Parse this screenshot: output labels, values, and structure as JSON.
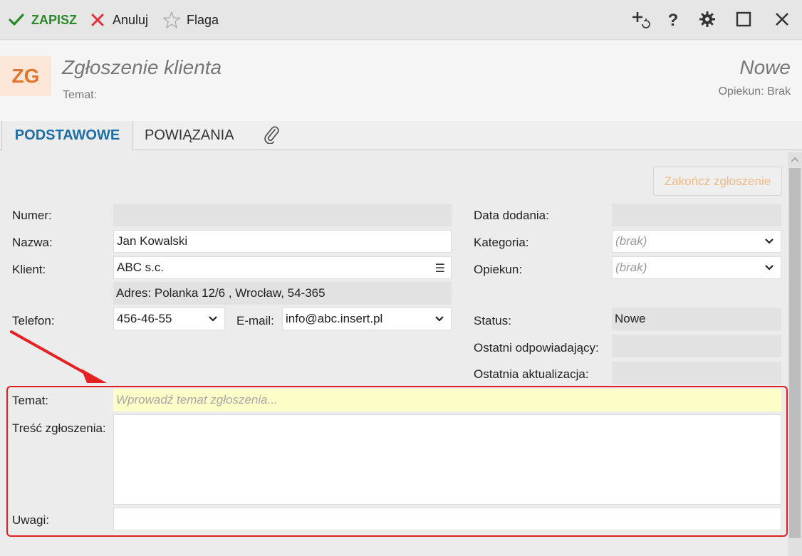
{
  "toolbar": {
    "save_label": "ZAPISZ",
    "cancel_label": "Anuluj",
    "flag_label": "Flaga"
  },
  "header": {
    "avatar_initials": "ZG",
    "title": "Zgłoszenie klienta",
    "subject_label": "Temat:",
    "status": "Nowe",
    "owner": "Opiekun: Brak"
  },
  "tabs": {
    "basic": "PODSTAWOWE",
    "relations": "POWIĄZANIA"
  },
  "actions": {
    "finish_label": "Zakończ zgłoszenie"
  },
  "form": {
    "numer_label": "Numer:",
    "numer_value": "",
    "nazwa_label": "Nazwa:",
    "nazwa_value": "Jan Kowalski",
    "klient_label": "Klient:",
    "klient_value": "ABC s.c.",
    "adres_value": "Adres:  Polanka  12/6 , Wrocław, 54-365",
    "telefon_label": "Telefon:",
    "telefon_value": "456-46-55",
    "email_label": "E-mail:",
    "email_value": "info@abc.insert.pl",
    "data_dodania_label": "Data dodania:",
    "data_dodania_value": "",
    "kategoria_label": "Kategoria:",
    "kategoria_value": "(brak)",
    "opiekun_label": "Opiekun:",
    "opiekun_value": "(brak)",
    "status_label": "Status:",
    "status_value": "Nowe",
    "ostatni_label": "Ostatni odpowiadający:",
    "ostatni_value": "",
    "aktualizacja_label": "Ostatnia aktualizacja:",
    "aktualizacja_value": "",
    "temat_label": "Temat:",
    "temat_placeholder": "Wprowadź temat zgłoszenia...",
    "tresc_label": "Treść zgłoszenia:",
    "uwagi_label": "Uwagi:"
  },
  "colors": {
    "accent_blue": "#1c6ea4",
    "save_green": "#2a8a2a",
    "cancel_red": "#e0303a",
    "avatar_orange": "#e0762c",
    "highlight_red": "#e02020",
    "temat_bg": "#fdfdc8"
  },
  "icons": {
    "save": "checkmark-icon",
    "cancel": "x-icon",
    "flag": "star-outline-icon",
    "new_linked": "plus-refresh-icon",
    "help": "question-icon",
    "settings": "gear-icon",
    "maximize": "square-icon",
    "close": "close-icon",
    "attachment": "paperclip-icon"
  }
}
